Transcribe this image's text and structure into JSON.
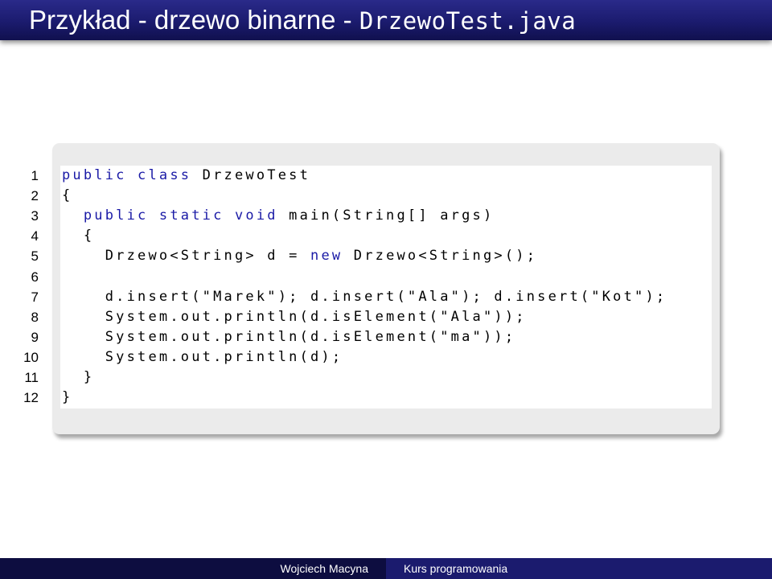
{
  "slide": {
    "title": "Przykład - drzewo binarne - ",
    "title_code": "DrzewoTest.java"
  },
  "code": {
    "lines": [
      {
        "n": "1",
        "tokens": [
          {
            "t": "public class",
            "kw": true
          },
          {
            "t": " DrzewoTest"
          }
        ]
      },
      {
        "n": "2",
        "tokens": [
          {
            "t": "{"
          }
        ]
      },
      {
        "n": "3",
        "tokens": [
          {
            "t": "  "
          },
          {
            "t": "public static void",
            "kw": true
          },
          {
            "t": " main(String[] args)"
          }
        ]
      },
      {
        "n": "4",
        "tokens": [
          {
            "t": "  {"
          }
        ]
      },
      {
        "n": "5",
        "tokens": [
          {
            "t": "    Drzewo<String> d = "
          },
          {
            "t": "new",
            "kw": true
          },
          {
            "t": " Drzewo<String>();"
          }
        ]
      },
      {
        "n": "6",
        "tokens": [
          {
            "t": ""
          }
        ]
      },
      {
        "n": "7",
        "tokens": [
          {
            "t": "    d.insert(\"Marek\"); d.insert(\"Ala\"); d.insert(\"Kot\");"
          }
        ]
      },
      {
        "n": "8",
        "tokens": [
          {
            "t": "    System.out.println(d.isElement(\"Ala\"));"
          }
        ]
      },
      {
        "n": "9",
        "tokens": [
          {
            "t": "    System.out.println(d.isElement(\"ma\"));"
          }
        ]
      },
      {
        "n": "10",
        "tokens": [
          {
            "t": "    System.out.println(d);"
          }
        ]
      },
      {
        "n": "11",
        "tokens": [
          {
            "t": "  }"
          }
        ]
      },
      {
        "n": "12",
        "tokens": [
          {
            "t": "}"
          }
        ]
      }
    ]
  },
  "footer": {
    "author": "Wojciech Macyna",
    "course": "Kurs programowania"
  },
  "colors": {
    "title_bar": "#1b1b6e",
    "keyword": "#1a1aa6",
    "code_frame": "#ebebeb",
    "footer_left": "#0d0d40",
    "footer_right": "#1b1b6e"
  }
}
